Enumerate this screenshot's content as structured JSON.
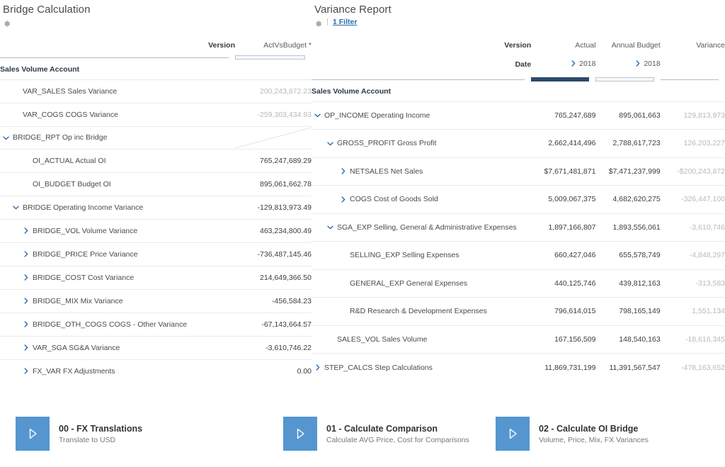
{
  "left_panel": {
    "title": "Bridge Calculation",
    "gear_icon": "gear-icon",
    "header": {
      "version_label": "Version",
      "version_value": "ActVsBudget *"
    },
    "dimension_header": "Sales Volume Account",
    "rows": [
      {
        "label": "VAR_SALES Sales Variance",
        "value": "200,243,872.23",
        "indent": 1,
        "toggle": "none",
        "muted": true,
        "blank": false
      },
      {
        "label": "VAR_COGS COGS Variance",
        "value": "-259,303,434.93",
        "indent": 1,
        "toggle": "none",
        "muted": true,
        "blank": false
      },
      {
        "label": "BRIDGE_RPT Op inc Bridge",
        "value": "",
        "indent": 0,
        "toggle": "expanded",
        "muted": false,
        "blank": true
      },
      {
        "label": "OI_ACTUAL Actual OI",
        "value": "765,247,689.29",
        "indent": 2,
        "toggle": "none",
        "muted": false,
        "blank": false
      },
      {
        "label": "OI_BUDGET Budget OI",
        "value": "895,061,662.78",
        "indent": 2,
        "toggle": "none",
        "muted": false,
        "blank": false
      },
      {
        "label": "BRIDGE Operating Income Variance",
        "value": "-129,813,973.49",
        "indent": 1,
        "toggle": "expanded",
        "muted": false,
        "blank": false
      },
      {
        "label": "BRIDGE_VOL Volume Variance",
        "value": "463,234,800.49",
        "indent": 2,
        "toggle": "collapsed",
        "muted": false,
        "blank": false
      },
      {
        "label": "BRIDGE_PRICE Price Variance",
        "value": "-736,487,145.46",
        "indent": 2,
        "toggle": "collapsed",
        "muted": false,
        "blank": false
      },
      {
        "label": "BRIDGE_COST Cost Variance",
        "value": "214,649,366.50",
        "indent": 2,
        "toggle": "collapsed",
        "muted": false,
        "blank": false
      },
      {
        "label": "BRIDGE_MIX Mix Variance",
        "value": "-456,584.23",
        "indent": 2,
        "toggle": "collapsed",
        "muted": false,
        "blank": false
      },
      {
        "label": "BRIDGE_OTH_COGS COGS - Other Variance",
        "value": "-67,143,664.57",
        "indent": 2,
        "toggle": "collapsed",
        "muted": false,
        "blank": false
      },
      {
        "label": "VAR_SGA SG&A Variance",
        "value": "-3,610,746.22",
        "indent": 2,
        "toggle": "collapsed",
        "muted": false,
        "blank": false
      },
      {
        "label": "FX_VAR FX Adjustments",
        "value": "0.00",
        "indent": 2,
        "toggle": "collapsed",
        "muted": false,
        "blank": false
      }
    ]
  },
  "right_panel": {
    "title": "Variance Report",
    "gear_icon": "gear-icon",
    "filter_label": "1 Filter",
    "header": {
      "version_label": "Version",
      "date_label": "Date",
      "columns": [
        {
          "version": "Actual",
          "date": "2018",
          "date_toggle": "collapsed",
          "bar": "solid"
        },
        {
          "version": "Annual Budget",
          "date": "2018",
          "date_toggle": "collapsed",
          "bar": "hollow"
        },
        {
          "version": "Variance",
          "date": "",
          "date_toggle": "none",
          "bar": "thin"
        }
      ]
    },
    "dimension_header": "Sales Volume Account",
    "rows": [
      {
        "label": "OP_INCOME Operating Income",
        "indent": 0,
        "toggle": "expanded",
        "values": [
          "765,247,689",
          "895,061,663",
          "129,813,973"
        ]
      },
      {
        "label": "GROSS_PROFIT Gross Profit",
        "indent": 1,
        "toggle": "expanded",
        "values": [
          "2,662,414,496",
          "2,788,617,723",
          "126,203,227"
        ]
      },
      {
        "label": "NETSALES Net Sales",
        "indent": 2,
        "toggle": "collapsed",
        "values": [
          "$7,671,481,871",
          "$7,471,237,999",
          "-$200,243,872"
        ]
      },
      {
        "label": "COGS Cost of Goods Sold",
        "indent": 2,
        "toggle": "collapsed",
        "values": [
          "5,009,067,375",
          "4,682,620,275",
          "-326,447,100"
        ]
      },
      {
        "label": "SGA_EXP Selling, General & Administrative Expenses",
        "indent": 1,
        "toggle": "expanded",
        "values": [
          "1,897,166,807",
          "1,893,556,061",
          "-3,610,746"
        ]
      },
      {
        "label": "SELLING_EXP Selling Expenses",
        "indent": 2,
        "toggle": "none",
        "values": [
          "660,427,046",
          "655,578,749",
          "-4,848,297"
        ]
      },
      {
        "label": "GENERAL_EXP General Expenses",
        "indent": 2,
        "toggle": "none",
        "values": [
          "440,125,746",
          "439,812,163",
          "-313,583"
        ]
      },
      {
        "label": "R&D Research & Development Expenses",
        "indent": 2,
        "toggle": "none",
        "values": [
          "796,614,015",
          "798,165,149",
          "1,551,134"
        ]
      },
      {
        "label": "SALES_VOL Sales Volume",
        "indent": 1,
        "toggle": "none",
        "values": [
          "167,156,509",
          "148,540,163",
          "-18,616,345"
        ]
      },
      {
        "label": "STEP_CALCS Step Calculations",
        "indent": 0,
        "toggle": "collapsed",
        "values": [
          "11,869,731,199",
          "11,391,567,547",
          "-478,163,652"
        ]
      }
    ]
  },
  "tiles": [
    {
      "icon": "play-icon",
      "title": "00 - FX Translations",
      "subtitle": "Translate to USD"
    },
    {
      "icon": "play-icon",
      "title": "01 - Calculate Comparison",
      "subtitle": "Calculate AVG Price, Cost for Comparisons"
    },
    {
      "icon": "play-icon",
      "title": "02 - Calculate OI Bridge",
      "subtitle": "Volume, Price, Mix, FX Variances"
    }
  ],
  "colors": {
    "accent_blue": "#2a6cb0",
    "tile_blue": "#5596d0",
    "bar_solid": "#2c4a68",
    "muted_text": "#b9b9b9"
  }
}
